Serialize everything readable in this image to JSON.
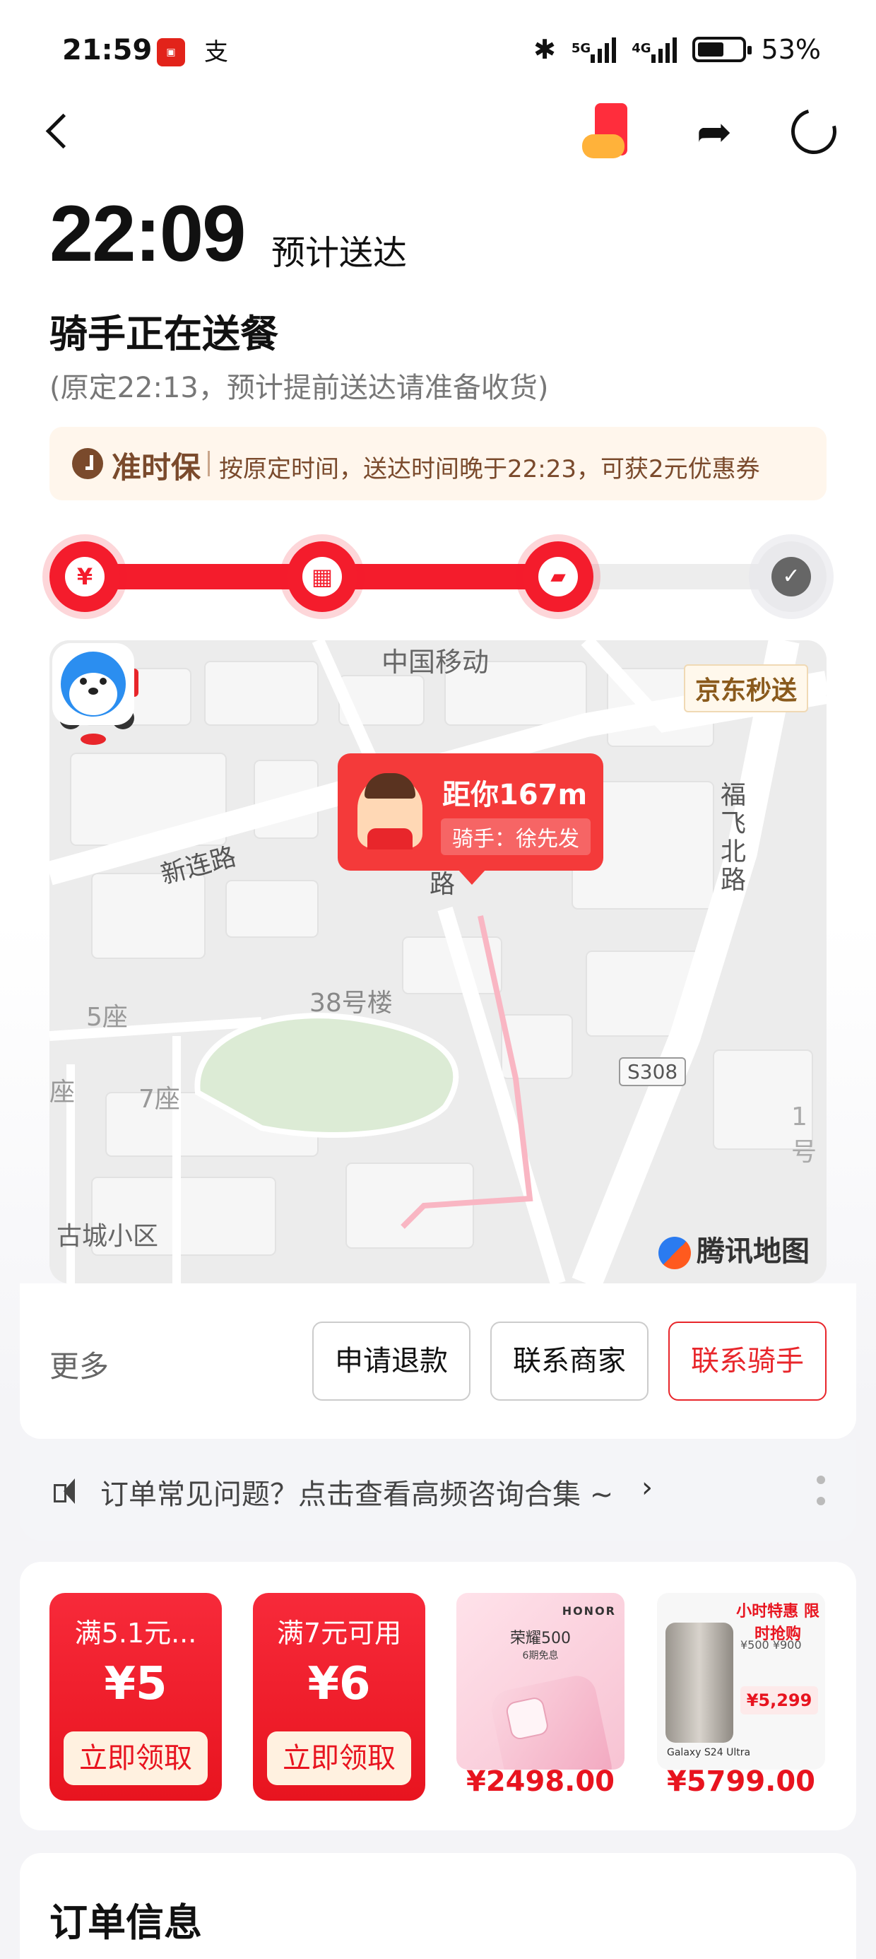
{
  "status_bar": {
    "time": "21:59",
    "app_icons": [
      "云闪付",
      "支"
    ],
    "network": "5G",
    "network2": "4G",
    "battery": "53%"
  },
  "nav": {
    "back_icon": "back-chevron-icon",
    "game_icon": "game-gift-icon",
    "share_icon": "share-icon",
    "refresh_icon": "refresh-icon"
  },
  "header": {
    "eta_time": "22:09",
    "eta_label": "预计送达",
    "status_title": "骑手正在送餐",
    "status_sub": "(原定22:13，预计提前送达请准备收货)"
  },
  "ontime": {
    "name": "准时保",
    "text": "按原定时间，送达时间晚于22:23，可获2元优惠券"
  },
  "progress": {
    "fill_fraction": 0.68,
    "steps": [
      {
        "name": "paid",
        "icon": "¥"
      },
      {
        "name": "merchant",
        "icon": "▦"
      },
      {
        "name": "delivering",
        "icon": "🛵"
      },
      {
        "name": "delivered",
        "icon": "✓"
      }
    ]
  },
  "map": {
    "carrier_watermark": "中国移动",
    "brand": "京东秒送",
    "distance": "距你167m",
    "rider": "骑手：徐先发",
    "labels": [
      "新连路",
      "福飞北路",
      "路",
      "38号楼",
      "5座",
      "座",
      "7座",
      "古城小区",
      "1号"
    ],
    "road_tag": "S308",
    "map_provider": "腾讯地图"
  },
  "actions": {
    "more": "更多",
    "refund": "申请退款",
    "contact_merchant": "联系商家",
    "contact_rider": "联系骑手"
  },
  "faq": {
    "text": "订单常见问题？点击查看高频咨询合集 ~",
    "arrow": "›"
  },
  "promos": {
    "coupons": [
      {
        "condition": "满5.1元...",
        "amount": "¥5",
        "button": "立即领取"
      },
      {
        "condition": "满7元可用",
        "amount": "¥6",
        "button": "立即领取"
      }
    ],
    "products": [
      {
        "brand": "HONOR",
        "name": "荣耀500",
        "sub": "6期免息",
        "price": "¥2498.00"
      },
      {
        "promo": "小时特惠 限时抢购",
        "tag": "¥500",
        "tag2": "¥900",
        "deal": "¥5,299",
        "model": "Galaxy S24 Ultra",
        "price": "¥5799.00"
      }
    ]
  },
  "order": {
    "title": "订单信息"
  }
}
